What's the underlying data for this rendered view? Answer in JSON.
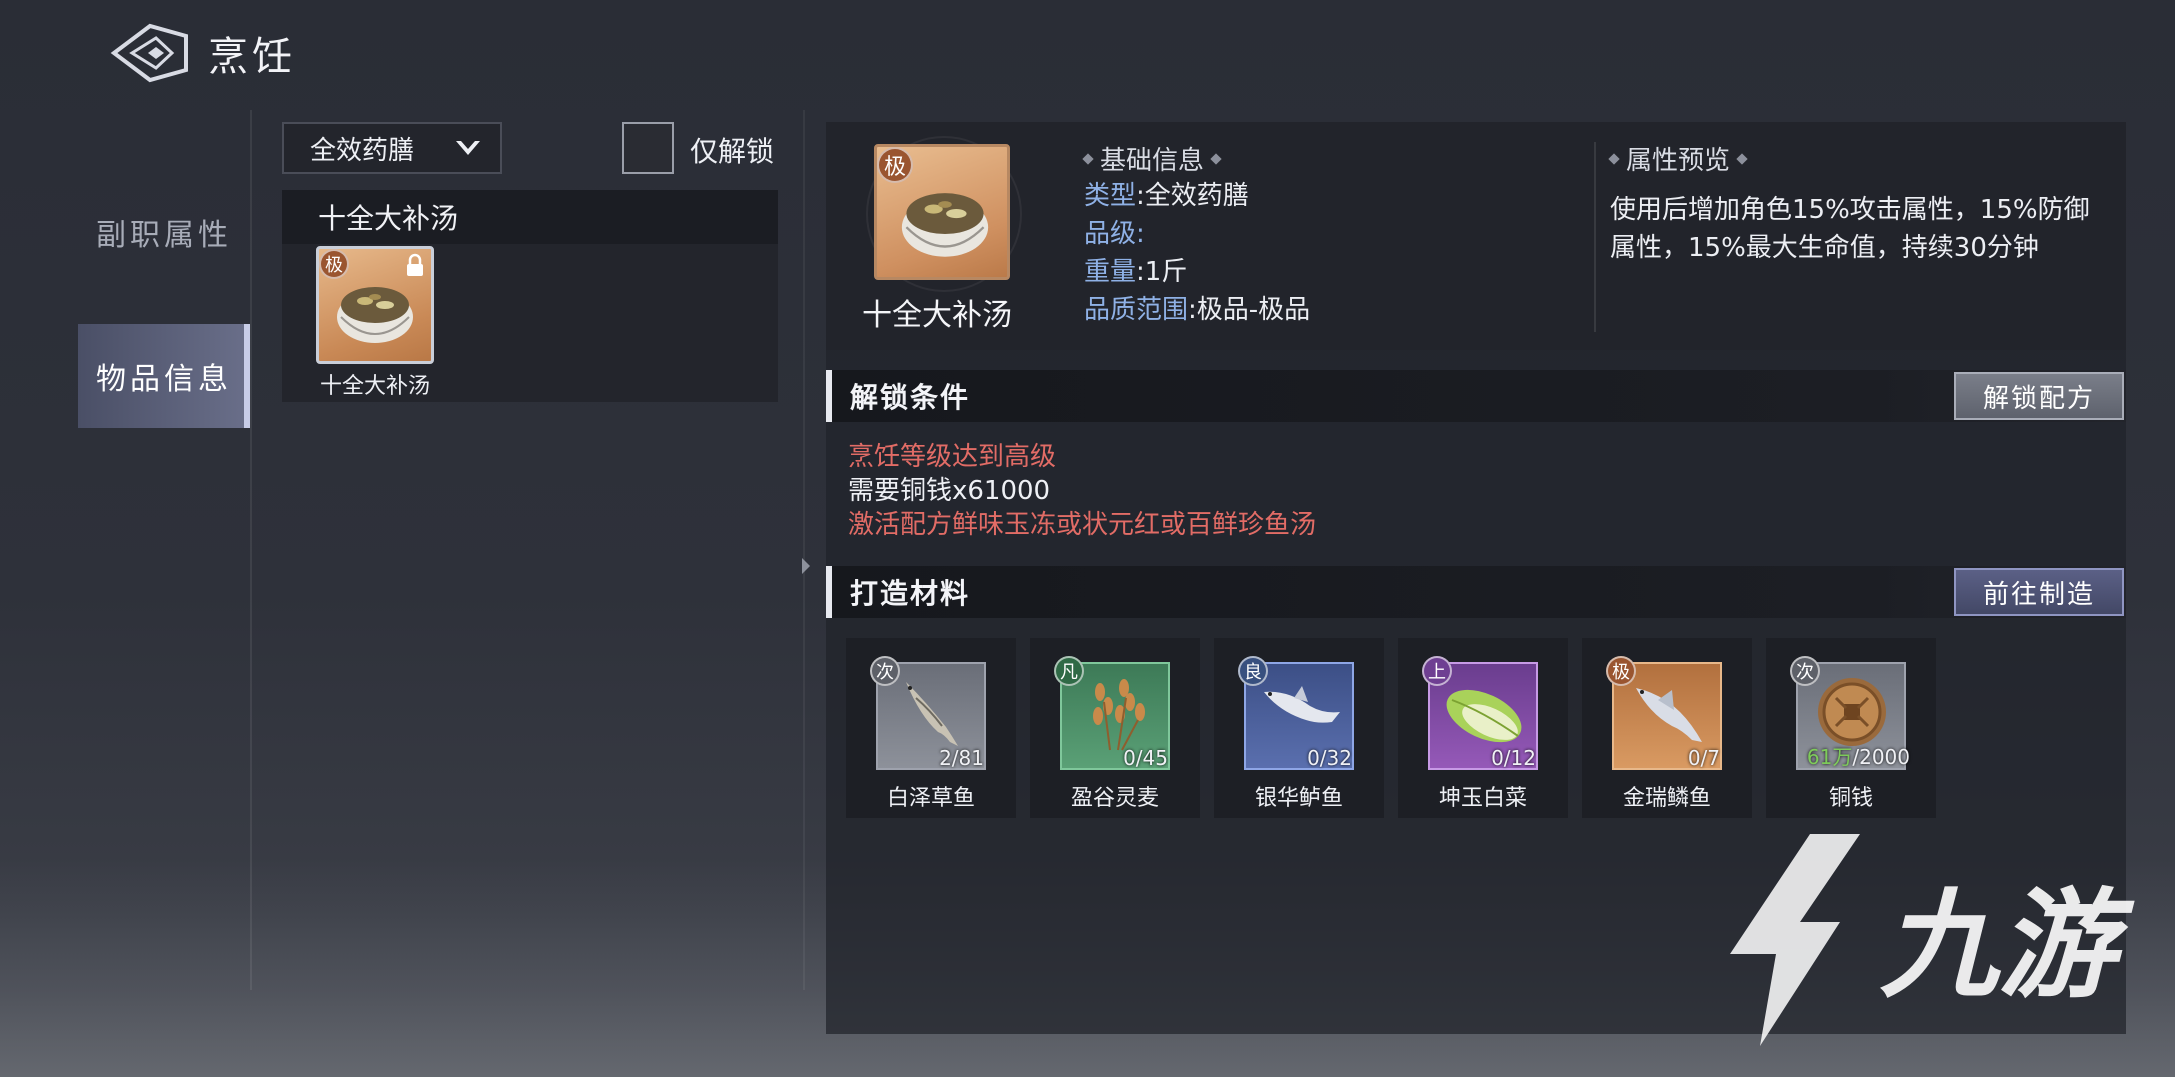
{
  "header": {
    "title": "烹饪"
  },
  "tabs": [
    {
      "label": "副职属性",
      "active": false
    },
    {
      "label": "物品信息",
      "active": true
    }
  ],
  "filter": {
    "selected": "全效药膳",
    "unlock_only_label": "仅解锁"
  },
  "recipe_list": {
    "header": "十全大补汤",
    "items": [
      {
        "name": "十全大补汤",
        "grade": "极",
        "locked": true
      }
    ]
  },
  "item": {
    "name": "十全大补汤",
    "grade": "极",
    "basic_title": "基础信息",
    "type_key": "类型",
    "type_value": ":全效药膳",
    "level_key": "品级",
    "level_value": ":",
    "weight_key": "重量",
    "weight_value": ":1斤",
    "quality_key": "品质范围",
    "quality_value": ":极品-极品",
    "attr_title": "属性预览",
    "attr_text": "使用后增加角色15%攻击属性，15%防御属性，15%最大生命值，持续30分钟"
  },
  "unlock": {
    "title": "解锁条件",
    "button": "解锁配方",
    "conditions": [
      {
        "text": "烹饪等级达到高级",
        "met": false
      },
      {
        "text": "需要铜钱x61000",
        "met": true
      },
      {
        "text": "激活配方鲜味玉冻或状元红或百鲜珍鱼汤",
        "met": false
      }
    ]
  },
  "materials": {
    "title": "打造材料",
    "button": "前往制造",
    "items": [
      {
        "name": "白泽草鱼",
        "grade": "次",
        "have": "",
        "count": "2/81",
        "icon": "fish-icon",
        "tier": "gray"
      },
      {
        "name": "盈谷灵麦",
        "grade": "凡",
        "have": "",
        "count": "0/45",
        "icon": "wheat-icon",
        "tier": "green"
      },
      {
        "name": "银华鲈鱼",
        "grade": "良",
        "have": "",
        "count": "0/32",
        "icon": "fish-icon",
        "tier": "blue"
      },
      {
        "name": "坤玉白菜",
        "grade": "上",
        "have": "",
        "count": "0/12",
        "icon": "cabbage-icon",
        "tier": "purple"
      },
      {
        "name": "金瑞鳞鱼",
        "grade": "极",
        "have": "",
        "count": "0/7",
        "icon": "fish-icon",
        "tier": "orange"
      },
      {
        "name": "铜钱",
        "grade": "次",
        "have": "61万",
        "count": "/2000",
        "icon": "coin-icon",
        "tier": "gray"
      }
    ]
  },
  "watermark": {
    "text": "九游"
  },
  "colors": {
    "red_text": "#e26c66",
    "key_blue": "#8fb1e6",
    "grade_orange": "#9a5530"
  }
}
